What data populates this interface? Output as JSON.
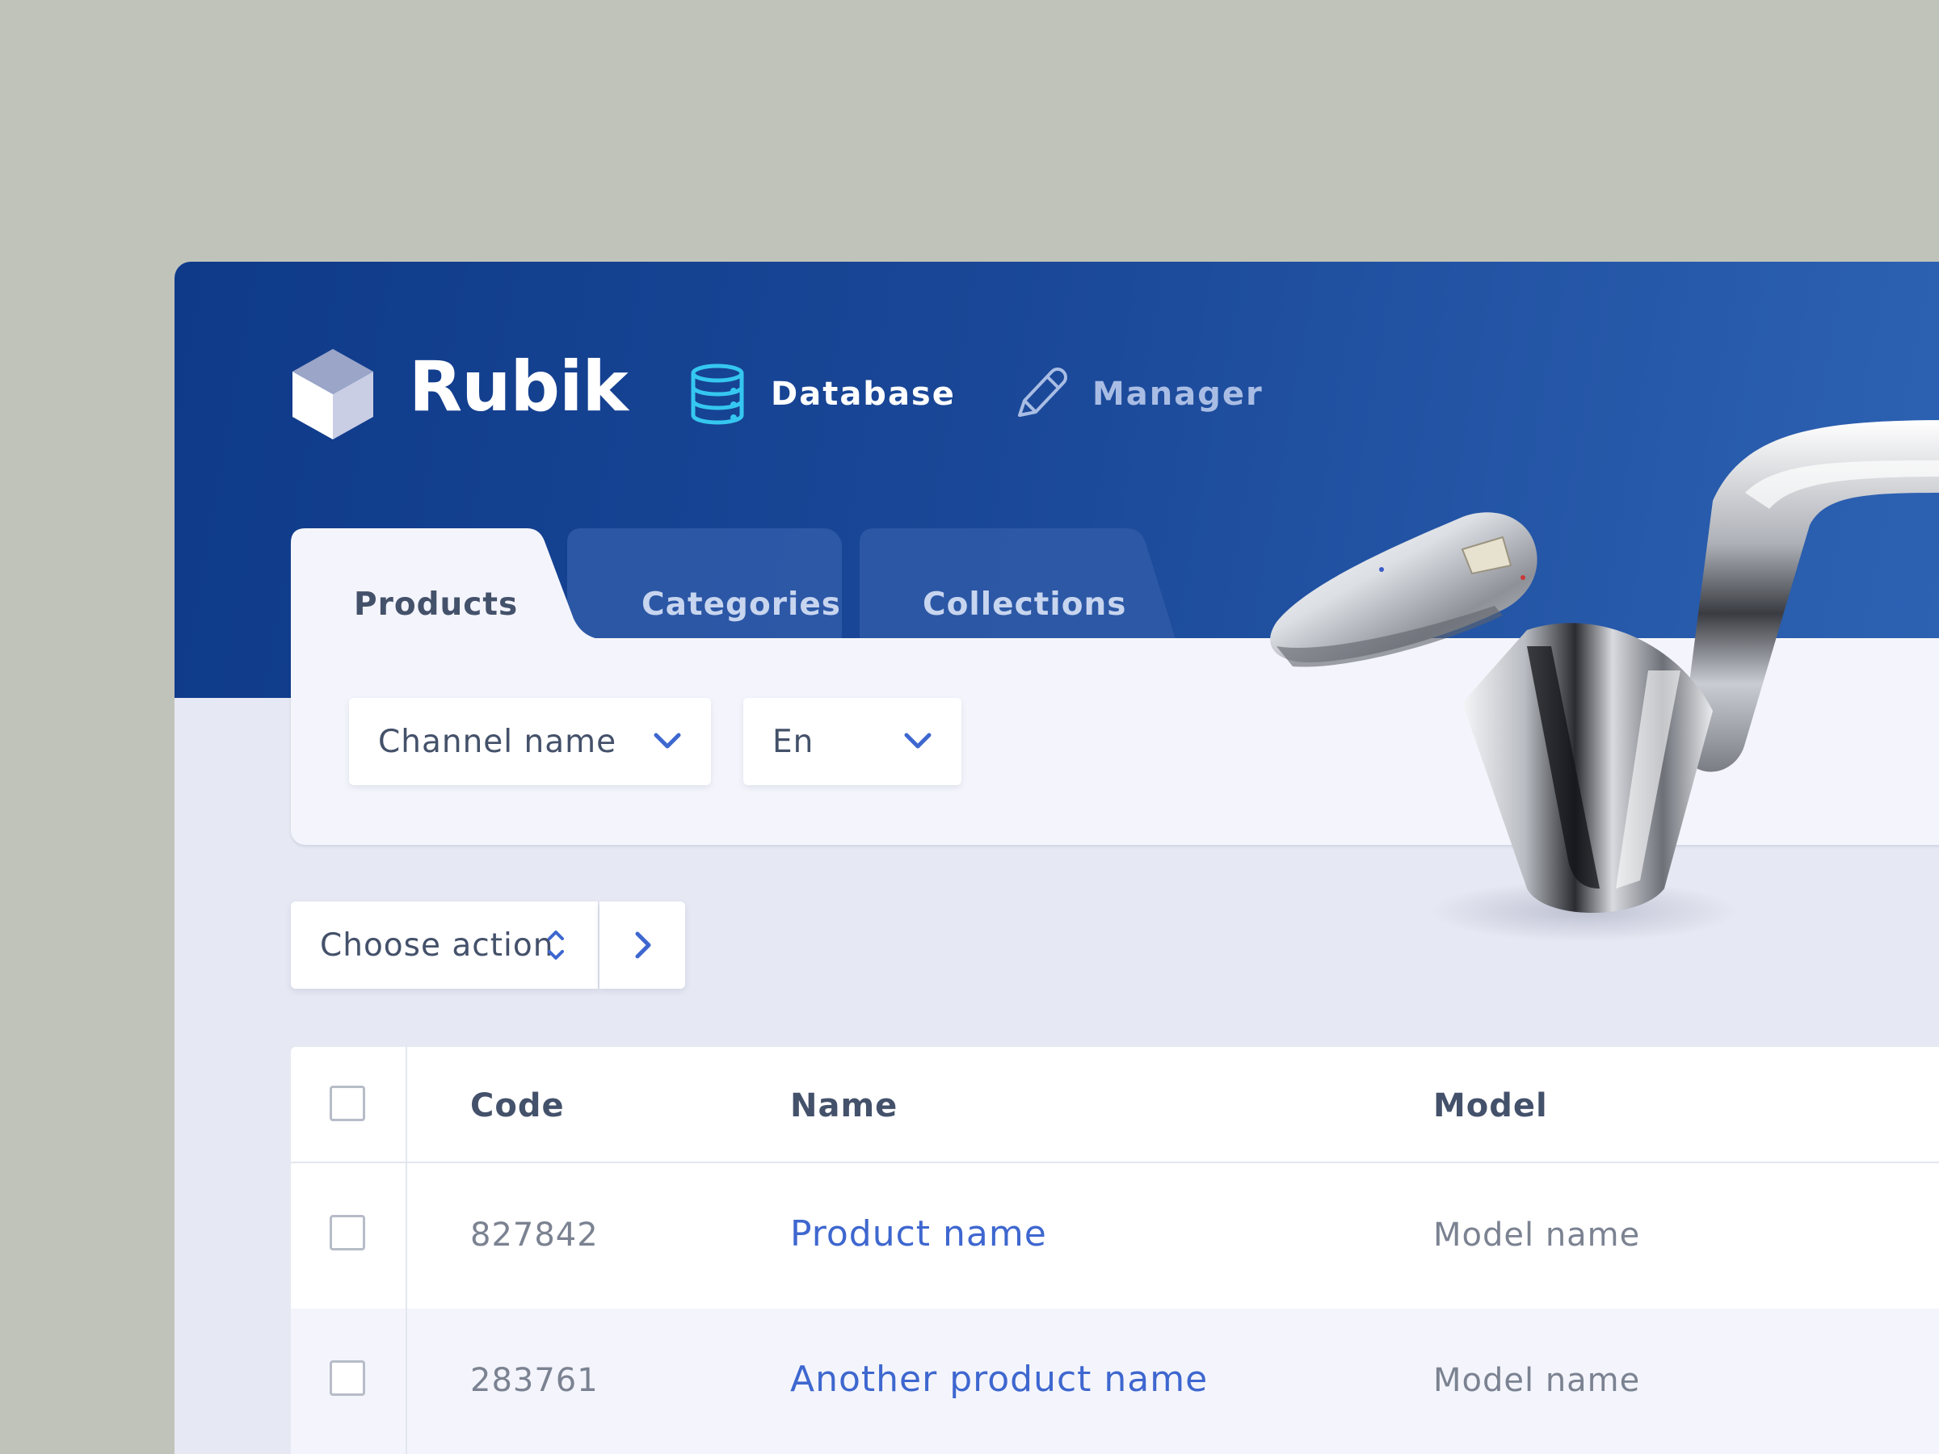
{
  "brand": {
    "title": "Rubik",
    "icon": "cube-logo-icon"
  },
  "nav": {
    "items": [
      {
        "label": "Database",
        "icon": "database-icon",
        "active": true
      },
      {
        "label": "Manager",
        "icon": "pencil-icon",
        "active": false
      }
    ]
  },
  "tabs": [
    {
      "label": "Products",
      "active": true
    },
    {
      "label": "Categories",
      "active": false
    },
    {
      "label": "Collections",
      "active": false
    }
  ],
  "filters": {
    "channel": {
      "value": "Channel name",
      "icon": "chevron-down-icon"
    },
    "language": {
      "value": "En",
      "icon": "chevron-down-icon"
    }
  },
  "actions": {
    "select": {
      "value": "Choose action",
      "icon": "up-down-icon"
    },
    "apply_icon": "chevron-right-icon"
  },
  "table": {
    "columns": [
      "Code",
      "Name",
      "Model"
    ],
    "rows": [
      {
        "code": "827842",
        "name": "Product name",
        "model": "Model name",
        "checked": false
      },
      {
        "code": "283761",
        "name": "Another product name",
        "model": "Model name",
        "checked": false
      }
    ]
  },
  "colors": {
    "header_start": "#0f3a8a",
    "header_end": "#2d62b3",
    "accent": "#3e67cf",
    "database_icon": "#35c7f0",
    "page_background": "#c0c3ba"
  }
}
